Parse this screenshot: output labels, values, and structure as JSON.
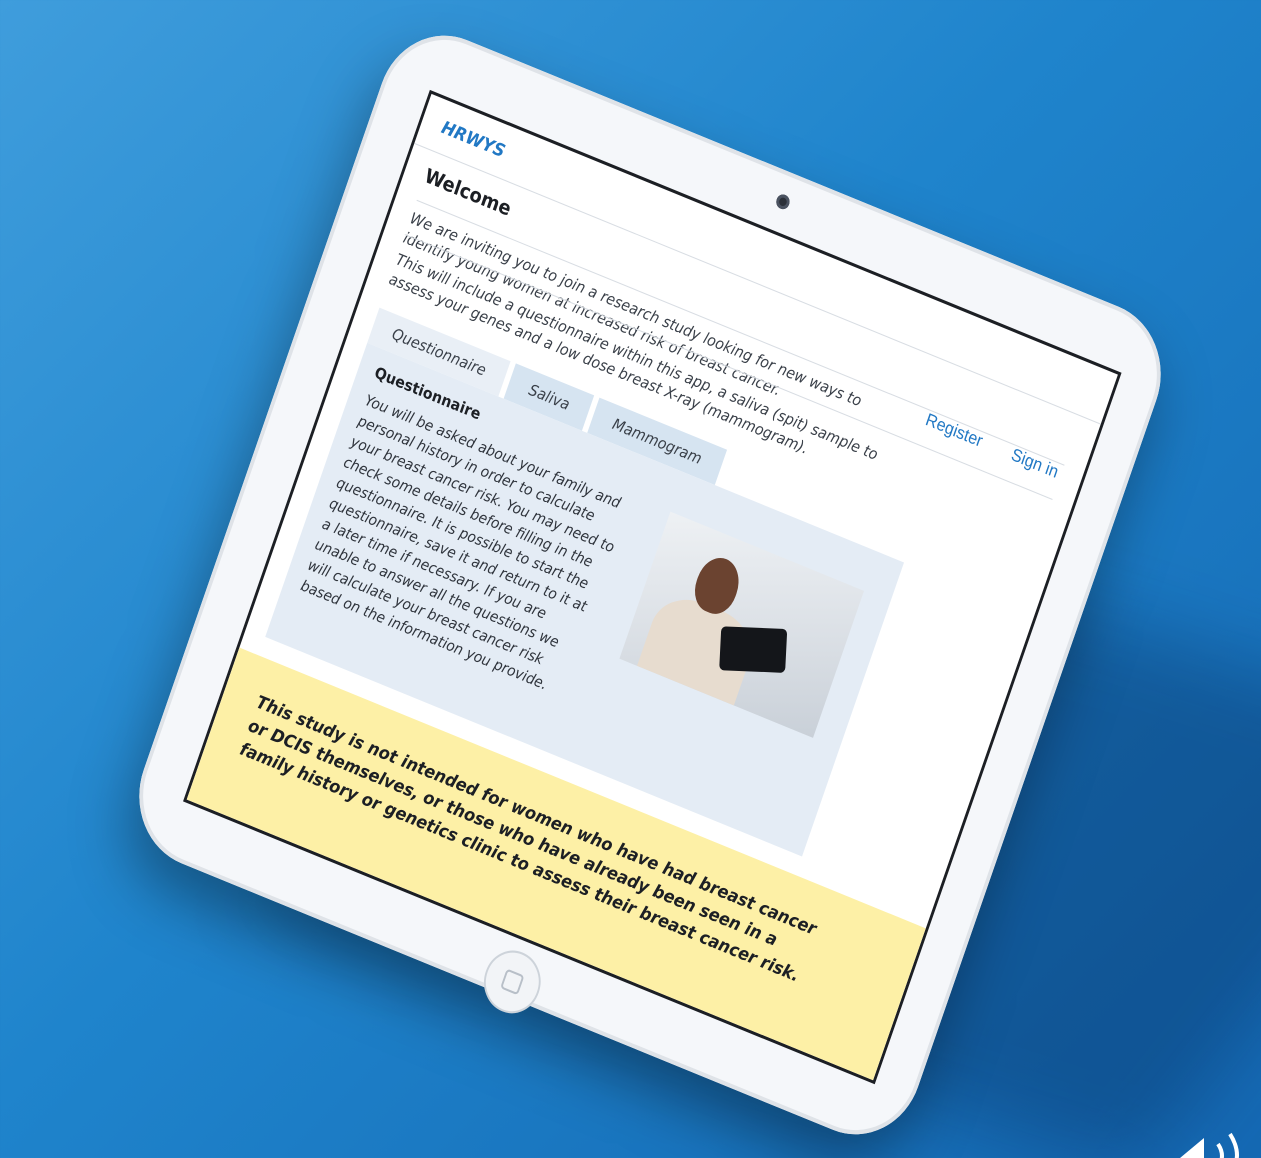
{
  "app": {
    "brand": "HRWYS"
  },
  "header": {
    "register_label": "Register",
    "signin_label": "Sign in"
  },
  "main": {
    "title": "Welcome",
    "intro_line1": "We are inviting you to join a research study looking for new ways to identify young women at increased risk of breast cancer.",
    "intro_line2": "This will include a questionnaire within this app, a saliva (spit) sample to assess your genes and a low dose breast X-ray (mammogram).",
    "tabs": [
      {
        "label": "Questionnaire",
        "active": true
      },
      {
        "label": "Saliva",
        "active": false
      },
      {
        "label": "Mammogram",
        "active": false
      }
    ],
    "panel": {
      "title": "Questionnaire",
      "text": "You will be asked about your family and personal history in order to calculate your breast cancer risk. You may need to check some details before filling in the questionnaire. It is possible to start the questionnaire, save it and return to it at a later time if necessary. If you are unable to answer all the questions we will calculate your breast cancer risk based on the information you provide."
    },
    "notice": "This study is not intended for women who have had breast cancer or DCIS themselves, or those who have already been seen in a family history or genetics clinic to assess their breast cancer risk."
  },
  "colors": {
    "accent": "#2178c4",
    "notice_bg": "#fdf0a6",
    "panel_bg": "#e4ecf5",
    "background": "#1f84cc"
  },
  "icons": {
    "sound": "speaker-icon",
    "home": "home-button-icon"
  }
}
